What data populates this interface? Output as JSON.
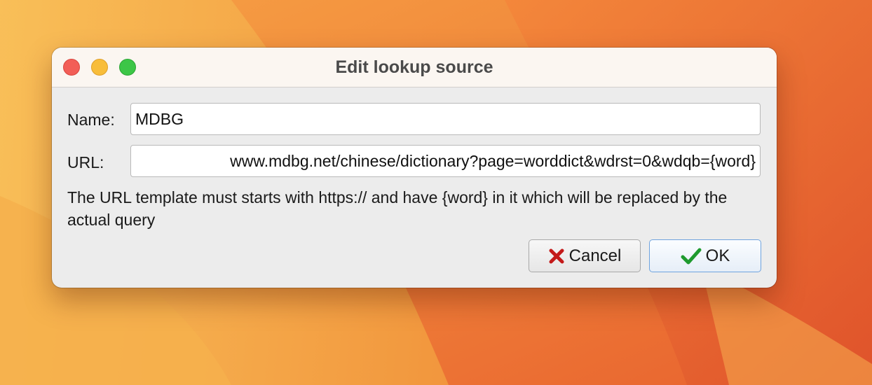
{
  "window": {
    "title": "Edit lookup source"
  },
  "form": {
    "name_label": "Name:",
    "name_value": "MDBG",
    "url_label": "URL:",
    "url_value": "www.mdbg.net/chinese/dictionary?page=worddict&wdrst=0&wdqb={word}",
    "hint": "The URL template must starts with https:// and have {word} in it which will be replaced by the actual query"
  },
  "buttons": {
    "cancel_label": "Cancel",
    "ok_label": "OK"
  },
  "icons": {
    "cancel": "x-icon",
    "ok": "checkmark-icon"
  },
  "colors": {
    "cancel_icon": "#c41a1a",
    "ok_icon": "#1e9a2e",
    "ok_border": "#6fa3de"
  }
}
